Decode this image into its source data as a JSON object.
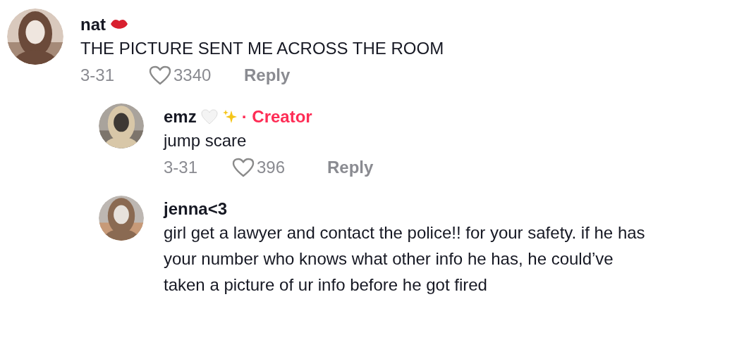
{
  "comments": [
    {
      "author": "nat",
      "name_icons": [
        {
          "kind": "lips"
        }
      ],
      "text": "THE PICTURE SENT ME ACROSS THE ROOM",
      "date": "3-31",
      "likes": "3340",
      "reply": "Reply",
      "reply_level": false,
      "avatar": {
        "kind": "picture"
      }
    },
    {
      "author": "emz",
      "name_icons": [
        {
          "kind": "white-heart"
        },
        {
          "kind": "sparkles"
        }
      ],
      "badge": "· Creator",
      "text": "jump scare",
      "date": "3-31",
      "likes": "396",
      "reply": "Reply",
      "reply_level": true,
      "avatar": {
        "kind": "picture"
      }
    },
    {
      "author": "jenna<3",
      "text": "girl get a lawyer and contact the police!! for your safety. if he has\nyour number who knows what other info he has, he could’ve\ntaken a picture of ur info before he got fired",
      "reply_level": true,
      "avatar": {
        "kind": "picture"
      }
    }
  ]
}
